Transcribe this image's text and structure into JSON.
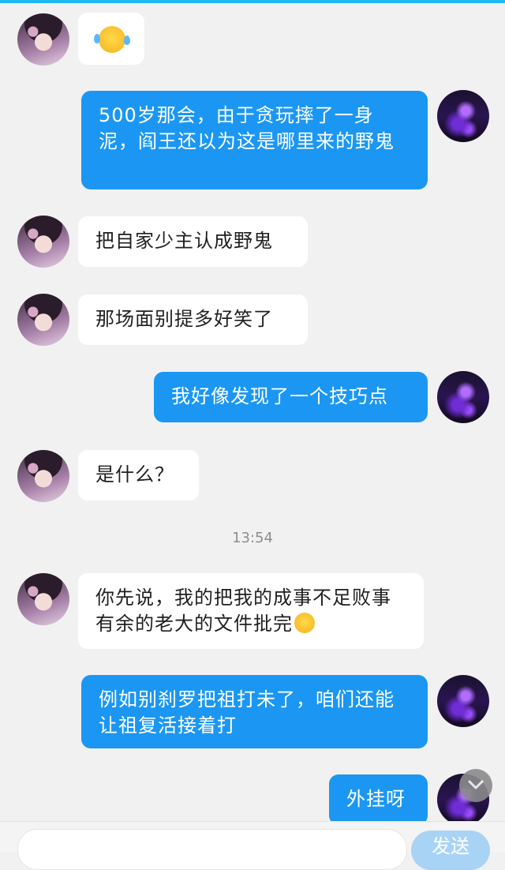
{
  "messages": [
    {
      "side": "in",
      "text": ""
    },
    {
      "side": "out",
      "text": "500岁那会，由于贪玩摔了一身泥，阎王还以为这是哪里来的野鬼"
    },
    {
      "side": "in",
      "text": "把自家少主认成野鬼"
    },
    {
      "side": "in",
      "text": "那场面别提多好笑了"
    },
    {
      "side": "out",
      "text": "我好像发现了一个技巧点"
    },
    {
      "side": "in",
      "text": "是什么？"
    },
    {
      "side": "in",
      "text": "你先说，我的把我的成事不足败事有余的老大的文件批完"
    },
    {
      "side": "out",
      "text": "例如别刹罗把祖打未了，咱们还能让祖复活接着打"
    },
    {
      "side": "out",
      "text": "外挂呀"
    }
  ],
  "timestamp": "13:54",
  "input": {
    "send_label": "发送"
  },
  "icons": {
    "crying_emoji": "crying-face-icon",
    "scroll_down": "chevron-down-icon"
  },
  "colors": {
    "accent": "#1b97f3",
    "top_bar": "#1fb8f1",
    "background": "#f1f1f1"
  }
}
